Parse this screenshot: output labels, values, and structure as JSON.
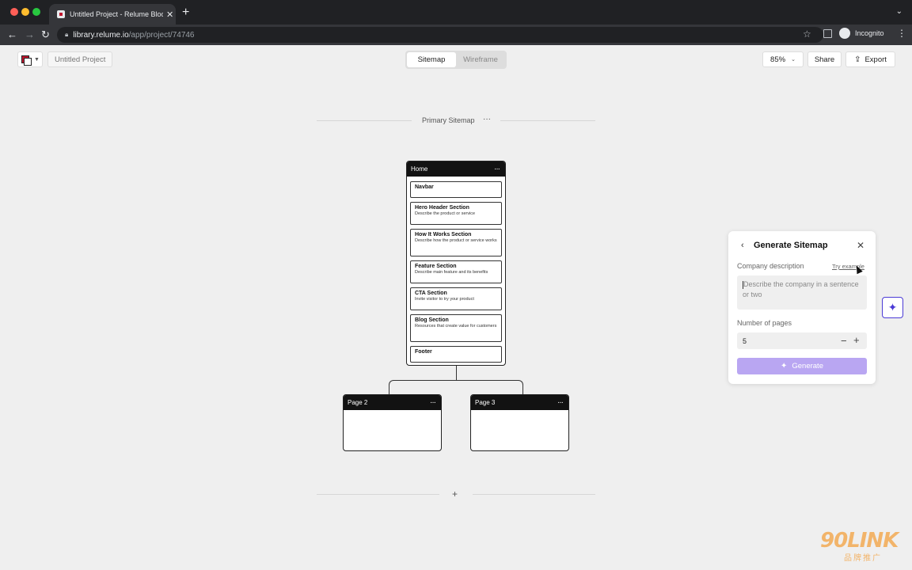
{
  "browser": {
    "tab_title": "Untitled Project - Relume Blocks",
    "url_host": "library.relume.io",
    "url_path": "/app/project/74746",
    "profile_label": "Incognito",
    "traffic_colors": [
      "#ff5f57",
      "#febc2e",
      "#28c840"
    ]
  },
  "toolbar": {
    "project_name": "Untitled Project",
    "tabs": [
      {
        "label": "Sitemap",
        "active": true
      },
      {
        "label": "Wireframe",
        "active": false
      }
    ],
    "zoom": "85%",
    "share_label": "Share",
    "export_label": "Export"
  },
  "sitemap": {
    "title": "Primary Sitemap",
    "home": {
      "name": "Home",
      "sections": [
        {
          "title": "Navbar",
          "desc": ""
        },
        {
          "title": "Hero Header Section",
          "desc": "Describe the product or service"
        },
        {
          "title": "How It Works Section",
          "desc": "Describe how the product or service works"
        },
        {
          "title": "Feature Section",
          "desc": "Describe main feature and its benefits"
        },
        {
          "title": "CTA Section",
          "desc": "Invite visitor to try your product"
        },
        {
          "title": "Blog Section",
          "desc": "Resources that create value for customers"
        },
        {
          "title": "Footer",
          "desc": ""
        }
      ]
    },
    "children": [
      {
        "name": "Page 2"
      },
      {
        "name": "Page 3"
      }
    ]
  },
  "generate_panel": {
    "title": "Generate Sitemap",
    "company_label": "Company description",
    "try_example": "Try example",
    "company_placeholder": "Describe the company in a sentence or two",
    "pages_label": "Number of pages",
    "pages_value": "5",
    "generate_label": "Generate",
    "accent_color": "#b9a6f2"
  },
  "watermark": {
    "brand": "90LINK",
    "sub": "品牌推广"
  }
}
